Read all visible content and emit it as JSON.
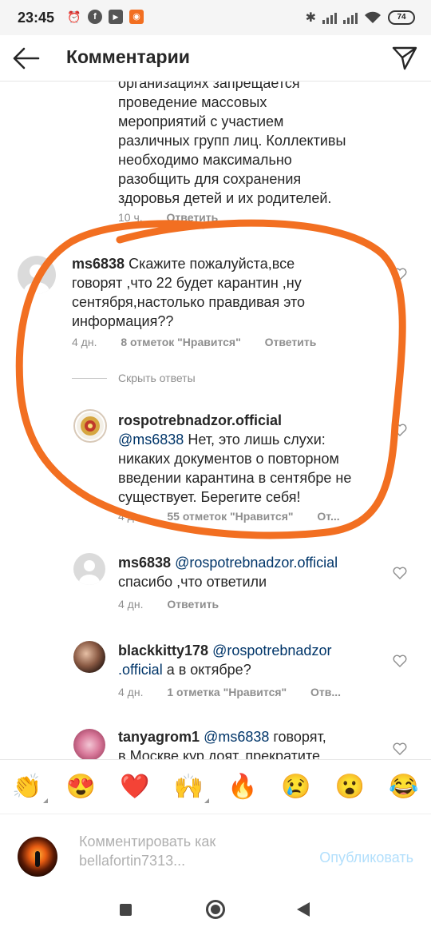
{
  "status_bar": {
    "time": "23:45",
    "battery": "74"
  },
  "header": {
    "title": "Комментарии"
  },
  "partial_comment": {
    "lines": [
      "организациях запрещается",
      "проведение массовых",
      "мероприятий с участием",
      "различных групп лиц. Коллективы",
      "необходимо максимально",
      "разобщить для сохранения",
      "здоровья детей и их родителей."
    ],
    "time": "10 ч.",
    "reply": "Ответить"
  },
  "comments": [
    {
      "username": "ms6838",
      "lines": [
        " Скажите пожалуйста,все",
        "говорят ,что 22 будет карантин ,ну",
        "сентября,настолько правдивая это",
        "информация??"
      ],
      "time": "4 дн.",
      "likes": "8 отметок \"Нравится\"",
      "reply": "Ответить"
    },
    {
      "username": "rospotrebnadzor.official",
      "mention": "@ms6838",
      "lines": [
        " Нет, это лишь слухи:",
        "никаких документов о повторном",
        "введении карантина в сентябре не",
        "существует. Берегите себя!"
      ],
      "time": "4 дн.",
      "likes": "55 отметок \"Нравится\"",
      "reply": "От..."
    },
    {
      "username": "ms6838",
      "mention": "@rospotrebnadzor.official",
      "lines": [
        "спасибо ,что ответили"
      ],
      "time": "4 дн.",
      "reply": "Ответить"
    },
    {
      "username": "blackkitty178",
      "mention": "@rospotrebnadzor",
      "mention2": ".official",
      "lines": [
        " а в октябре?"
      ],
      "time": "4 дн.",
      "likes": "1 отметка \"Нравится\"",
      "reply": "Отв..."
    },
    {
      "username": "tanyagrom1",
      "mention": "@ms6838",
      "lines": [
        " говорят,",
        "в Москве кур доят, прекратите"
      ]
    }
  ],
  "hide_replies": "Скрыть ответы",
  "emojis": [
    "👏",
    "😍",
    "❤️",
    "🙌",
    "🔥",
    "😢",
    "😮",
    "😂"
  ],
  "comment_input": {
    "placeholder_line1": "Комментировать как",
    "placeholder_line2": "bellafortin7313...",
    "publish": "Опубликовать"
  },
  "annotation_color": "#f26f21"
}
